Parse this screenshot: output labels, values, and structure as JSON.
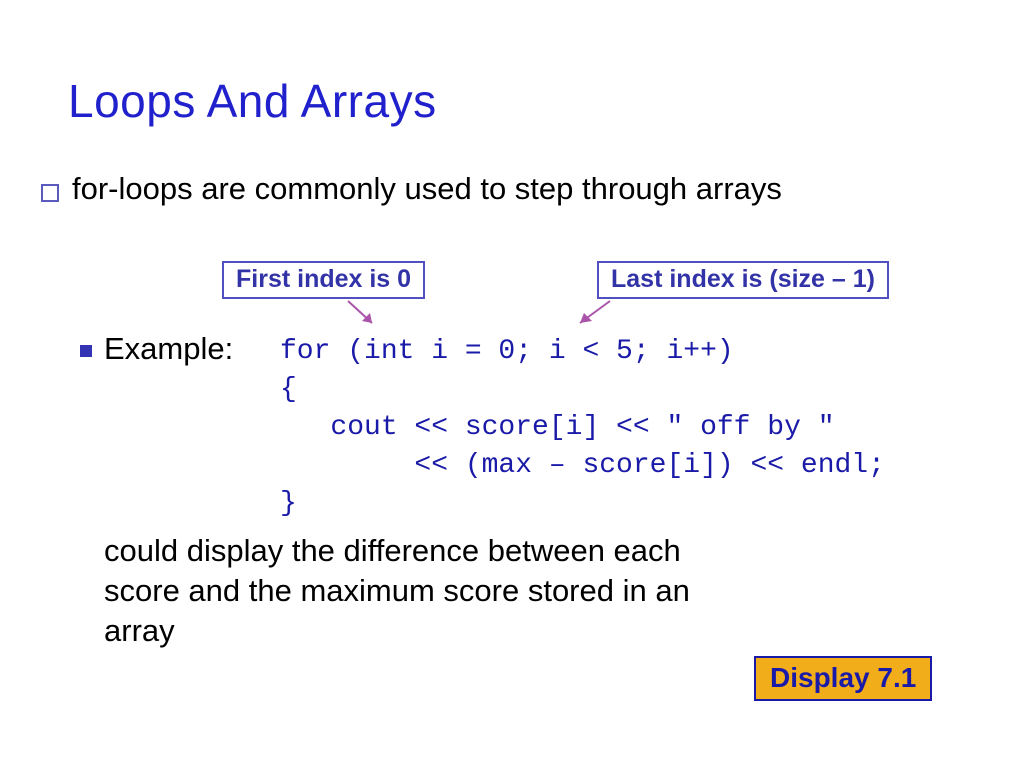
{
  "title": "Loops And Arrays",
  "bullet1": "for-loops are commonly used to step through arrays",
  "callouts": {
    "first": "First index is 0",
    "last": "Last index is (size – 1)"
  },
  "example_label": "Example:",
  "code": {
    "l1": "for (int i = 0; i < 5; i++)",
    "l2": "{",
    "l3": "   cout << score[i] << \" off by \"",
    "l4": "        << (max – score[i]) << endl;",
    "l5": "}"
  },
  "desc1": "could display the difference between each",
  "desc2": "score and the maximum score stored in an",
  "desc3": "array",
  "button": "Display 7.1"
}
